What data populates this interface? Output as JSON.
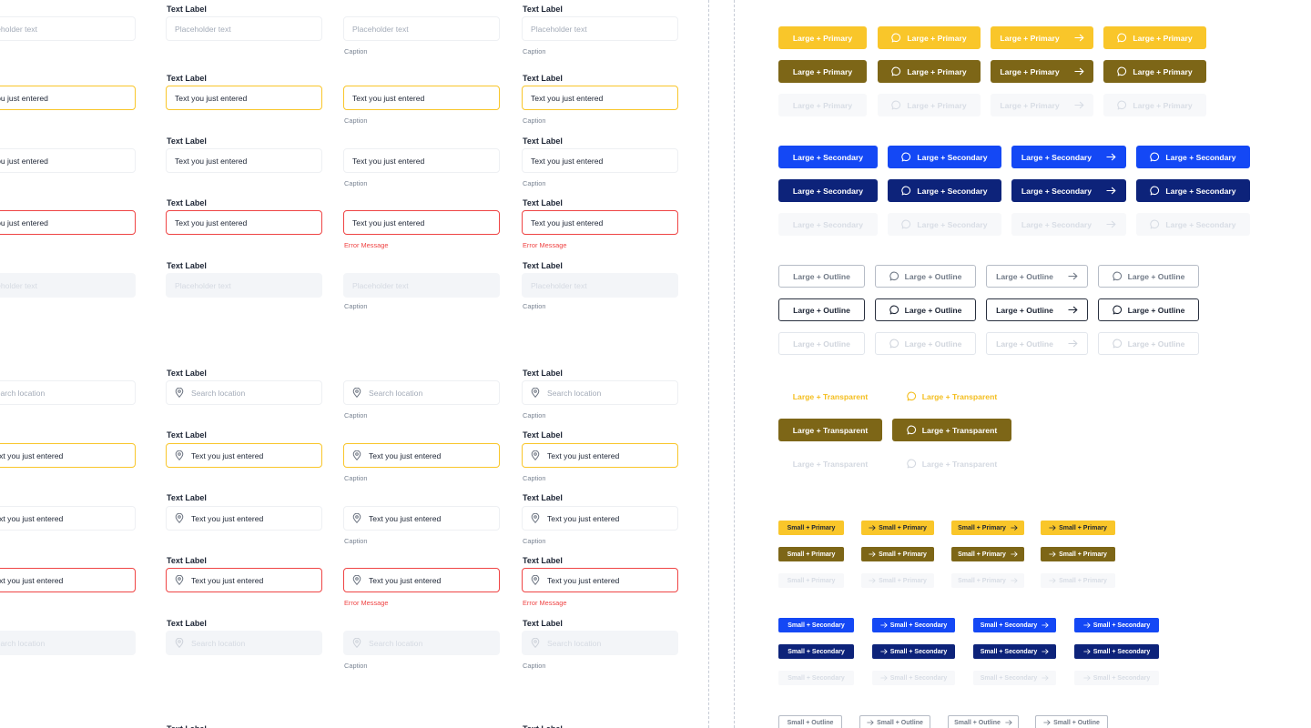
{
  "inputs": {
    "label": "Text Label",
    "placeholder": "Placeholder text",
    "cut_placeholder": "aceholder text",
    "value": "Text you just entered",
    "cut_value": "t you just entered",
    "caption": "Caption",
    "error": "Error Message",
    "search_placeholder": "Search location",
    "pin_icon": "location-pin-icon"
  },
  "colors": {
    "primary": "#f9c62a",
    "primary_dark": "#7d6617",
    "secondary": "#1448f5",
    "secondary_dark": "#0d237a",
    "error": "#ef4444"
  },
  "buttons": {
    "large_primary": "Large + Primary",
    "large_secondary": "Large + Secondary",
    "large_outline": "Large + Outline",
    "large_transparent": "Large + Transparent",
    "small_primary": "Small + Primary",
    "small_secondary": "Small + Secondary",
    "small_outline": "Small + Outline",
    "icons": [
      "chat-bubble-icon",
      "arrow-right-icon"
    ]
  }
}
